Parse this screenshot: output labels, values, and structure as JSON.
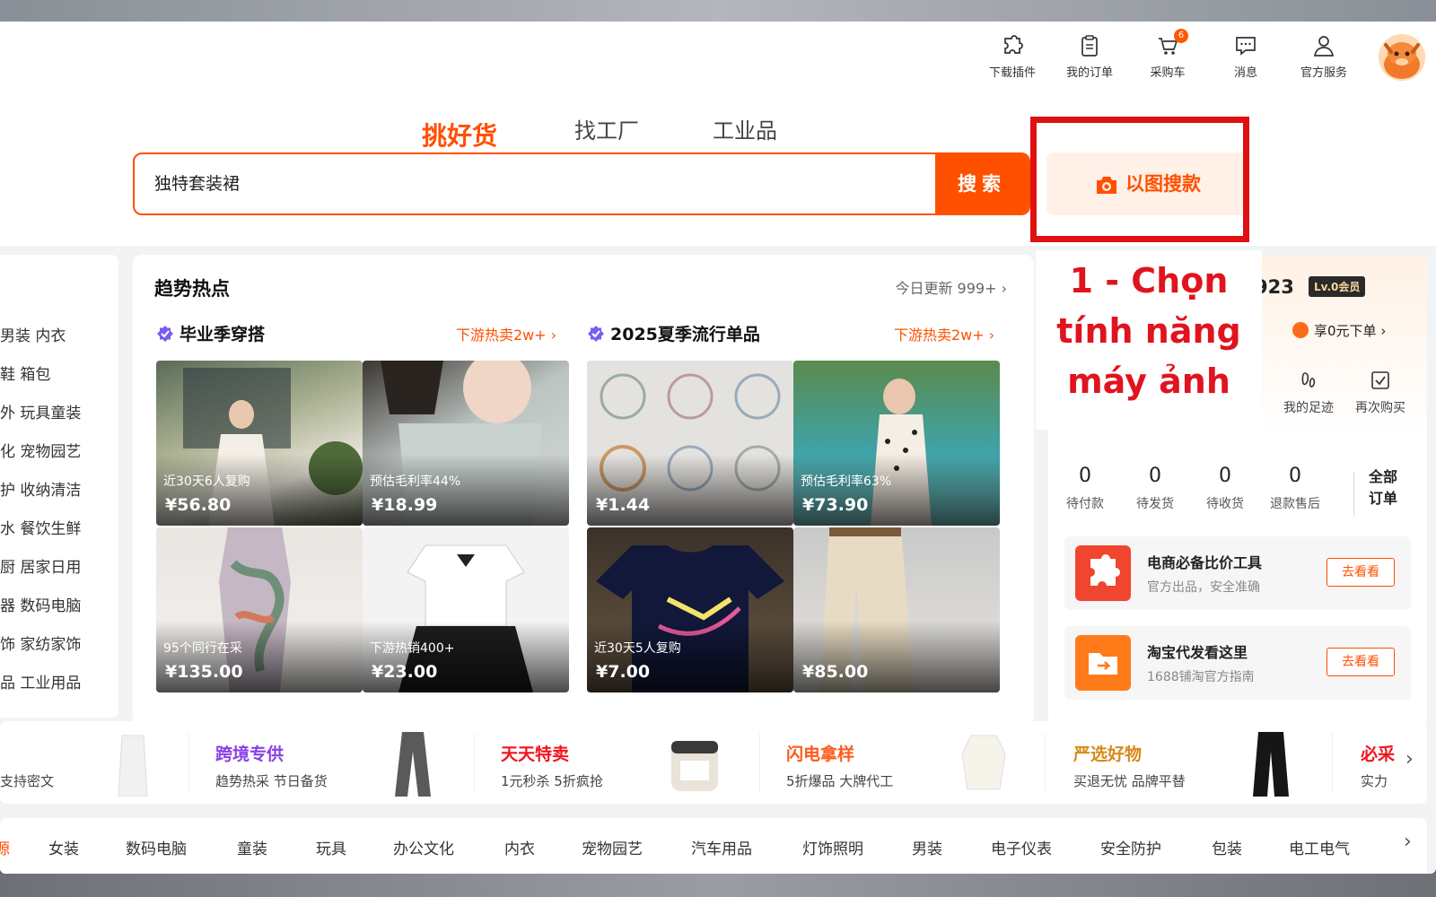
{
  "header": {
    "nav_items": [
      {
        "label": "下载插件",
        "icon": "puzzle-icon"
      },
      {
        "label": "我的订单",
        "icon": "clipboard-icon"
      },
      {
        "label": "采购车",
        "icon": "cart-icon",
        "badge": "6"
      },
      {
        "label": "消息",
        "icon": "chat-icon"
      },
      {
        "label": "官方服务",
        "icon": "user-icon"
      }
    ]
  },
  "tabs": [
    {
      "label": "挑好货",
      "active": true
    },
    {
      "label": "找工厂",
      "active": false
    },
    {
      "label": "工业品",
      "active": false
    }
  ],
  "search": {
    "value": "独特套装裙",
    "button": "搜索",
    "image_search": "以图搜款"
  },
  "annotation": {
    "lines": [
      "1 - Chọn",
      "tính năng",
      "máy ảnh"
    ]
  },
  "left_categories": [
    "男装  内衣",
    "鞋  箱包",
    "外  玩具童装",
    "化  宠物园艺",
    "护  收纳清洁",
    "水  餐饮生鲜",
    "厨  居家日用",
    "器  数码电脑",
    "饰  家纺家饰",
    "品  工业用品"
  ],
  "trends": {
    "title": "趋势热点",
    "update": "今日更新 999+",
    "groups": [
      {
        "title": "毕业季穿搭",
        "more": "下游热卖2w+",
        "items": [
          {
            "tag": "近30天6人复购",
            "price": "¥56.80"
          },
          {
            "tag": "预估毛利率44%",
            "price": "¥18.99"
          },
          {
            "tag": "95个同行在采",
            "price": "¥135.00"
          },
          {
            "tag": "下游热销400+",
            "price": "¥23.00"
          }
        ]
      },
      {
        "title": "2025夏季流行单品",
        "more": "下游热卖2w+",
        "items": [
          {
            "tag": "",
            "price": "¥1.44"
          },
          {
            "tag": "预估毛利率63%",
            "price": "¥73.90"
          },
          {
            "tag": "近30天5人复购",
            "price": "¥7.00"
          },
          {
            "tag": "",
            "price": "¥85.00"
          }
        ]
      }
    ]
  },
  "account": {
    "id_suffix": "923",
    "level": "Lv.0会员",
    "perk": "享0元下单",
    "quick_links": [
      "我的足迹",
      "再次购买"
    ],
    "stats": [
      {
        "num": "0",
        "label": "待付款"
      },
      {
        "num": "0",
        "label": "待发货"
      },
      {
        "num": "0",
        "label": "待收货"
      },
      {
        "num": "0",
        "label": "退款售后"
      }
    ],
    "all_orders": [
      "全部",
      "订单"
    ],
    "tools": [
      {
        "title": "电商必备比价工具",
        "sub": "官方出品，安全准确",
        "button": "去看看",
        "color": "#f0452e"
      },
      {
        "title": "淘宝代发看这里",
        "sub": "1688铺淘官方指南",
        "button": "去看看",
        "color": "#ff7b1a"
      }
    ]
  },
  "promos": [
    {
      "name": "",
      "desc": "支持密文",
      "color": "#3e6ef0"
    },
    {
      "name": "跨境专供",
      "desc": "趋势热采 节日备货",
      "color": "#8a3fe6"
    },
    {
      "name": "天天特卖",
      "desc": "1元秒杀 5折疯抢",
      "color": "#f0141e"
    },
    {
      "name": "闪电拿样",
      "desc": "5折爆品 大牌代工",
      "color": "#ff5a1a"
    },
    {
      "name": "严选好物",
      "desc": "买退无忧 品牌平替",
      "color": "#d98a1a"
    },
    {
      "name": "必采",
      "desc": "实力",
      "color": "#f0141e"
    }
  ],
  "bottom_categories": [
    "源",
    "女装",
    "数码电脑",
    "童装",
    "玩具",
    "办公文化",
    "内衣",
    "宠物园艺",
    "汽车用品",
    "灯饰照明",
    "男装",
    "电子仪表",
    "安全防护",
    "包装",
    "电工电气"
  ]
}
